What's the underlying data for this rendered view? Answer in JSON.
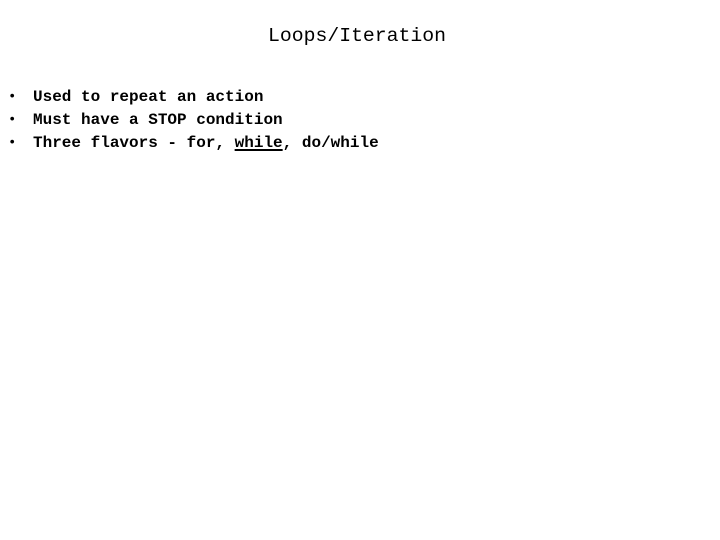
{
  "slide": {
    "title": "Loops/Iteration",
    "bullets": [
      {
        "text": "Used to repeat an action"
      },
      {
        "text": "Must have a STOP condition"
      },
      {
        "pre": "Three flavors - for, ",
        "underlined": "while",
        "post": ", do/while"
      }
    ],
    "bullet_glyph": "•"
  }
}
